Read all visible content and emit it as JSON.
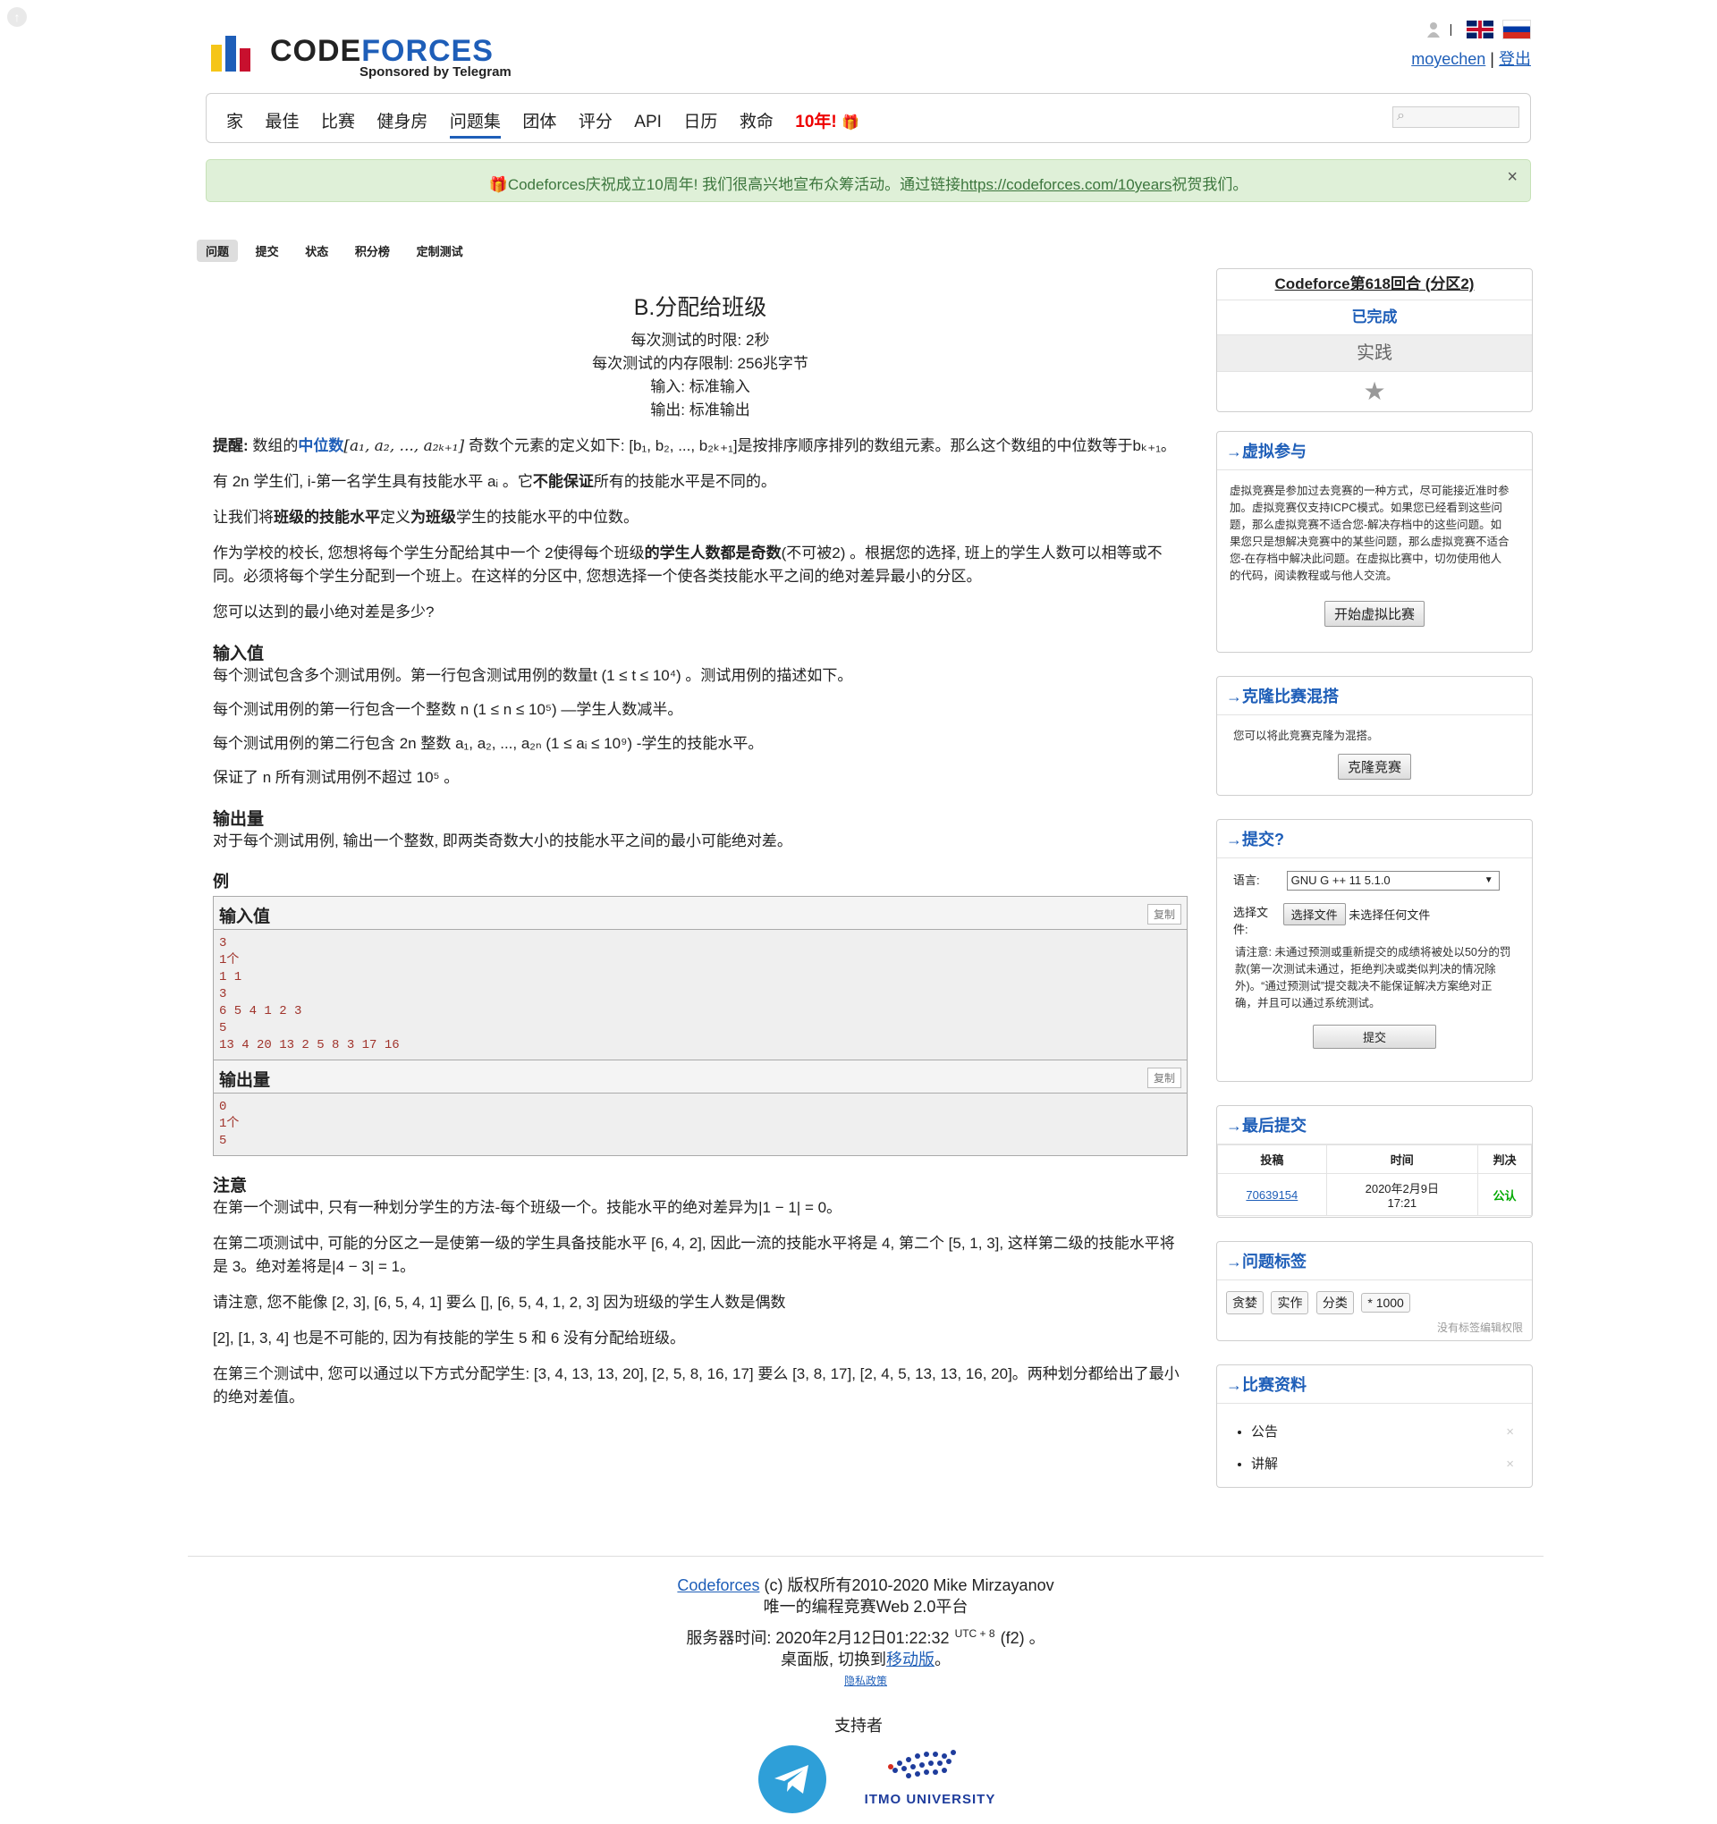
{
  "header": {
    "logo_text_a": "CODE",
    "logo_text_b": "FORCES",
    "sponsored": "Sponsored by Telegram",
    "username": "moyechen",
    "separator": "|",
    "logout": "登出",
    "lang_sep": "|"
  },
  "menu": [
    "家",
    "最佳",
    "比赛",
    "健身房",
    "问题集",
    "团体",
    "评分",
    "API",
    "日历",
    "救命",
    "10年!"
  ],
  "alert": {
    "prefix": "Codeforces庆祝成立10周年! 我们很高兴地宣布众筹活动。通过链接",
    "link": "https://codeforces.com/10years",
    "suffix": "祝贺我们。",
    "close": "×"
  },
  "subtabs": [
    "问题",
    "提交",
    "状态",
    "积分榜",
    "定制测试"
  ],
  "problem": {
    "title": "B.分配给班级",
    "time_limit": "每次测试的时限: 2秒",
    "memory_limit": "每次测试的内存限制: 256兆字节",
    "input": "输入: 标准输入",
    "output": "输出: 标准输出",
    "p1a": "提醒:",
    "p1b": "数组的",
    "p1c": "中位数",
    "p1d": "[a₁, a₂, ..., a₂ₖ₊₁]",
    "p1e": "奇数个元素的定义如下: [b₁, b₂, ..., b₂ₖ₊₁]是按排序顺序排列的数组元素。那么这个数组的中位数等于bₖ₊₁。",
    "p2": "有 2n 学生们, i-第一名学生具有技能水平 aᵢ 。它",
    "p2b": "不能保证",
    "p2c": "所有的技能水平是不同的。",
    "p3a": "让我们将",
    "p3b": "班级的技能水平",
    "p3c": "定义",
    "p3d": "为班级",
    "p3e": "学生的技能水平的中位数。",
    "p4a": "作为学校的校长, 您想将每个学生分配给其中一个 2使得每个班级",
    "p4b": "的学生人数都是奇数",
    "p4c": "(不可被2) 。根据您的选择, 班上的学生人数可以相等或不同。必须将每个学生分配到一个班上。在这样的分区中, 您想选择一个使各类技能水平之间的绝对差异最小的分区。",
    "p5": "您可以达到的最小绝对差是多少?",
    "input_head": "输入值",
    "in1": "每个测试包含多个测试用例。第一行包含测试用例的数量t (1 ≤ t ≤ 10⁴) 。测试用例的描述如下。",
    "in2": "每个测试用例的第一行包含一个整数 n (1 ≤ n ≤ 10⁵) —学生人数减半。",
    "in3": "每个测试用例的第二行包含 2n 整数 a₁, a₂, ..., a₂ₙ (1 ≤ aᵢ ≤ 10⁹) -学生的技能水平。",
    "in4": "保证了 n 所有测试用例不超过 10⁵ 。",
    "output_head": "输出量",
    "out1": "对于每个测试用例, 输出一个整数, 即两类奇数大小的技能水平之间的最小可能绝对差。",
    "example": "例",
    "sample_in_title": "输入值",
    "sample_out_title": "输出量",
    "copy": "复制",
    "sample_in": "3\n1个\n1 1\n3\n6 5 4 1 2 3\n5\n13 4 20 13 2 5 8 3 17 16",
    "sample_out": "0\n1个\n5",
    "note_head": "注意",
    "n1": "在第一个测试中, 只有一种划分学生的方法-每个班级一个。技能水平的绝对差异为|1 − 1| = 0。",
    "n2": "在第二项测试中, 可能的分区之一是使第一级的学生具备技能水平 [6, 4, 2], 因此一流的技能水平将是 4, 第二个 [5, 1, 3], 这样第二级的技能水平将是 3。绝对差将是|4 − 3| = 1。",
    "n3": "请注意, 您不能像 [2, 3], [6, 5, 4, 1] 要么 [], [6, 5, 4, 1, 2, 3] 因为班级的学生人数是偶数",
    "n4": "[2], [1, 3, 4] 也是不可能的, 因为有技能的学生 5 和 6 没有分配给班级。",
    "n5": "在第三个测试中, 您可以通过以下方式分配学生: [3, 4, 13, 13, 20], [2, 5, 8, 16, 17] 要么 [3, 8, 17], [2, 4, 5, 13, 13, 16, 20]。两种划分都给出了最小的绝对差值。"
  },
  "sidebar": {
    "contest_name": "Codeforce第618回合 (分区2)",
    "finished": "已完成",
    "practice": "实践",
    "virtual_title": "→虚拟参与",
    "virtual_text": "虚拟竞赛是参加过去竞赛的一种方式，尽可能接近准时参加。虚拟竞赛仅支持ICPC模式。如果您已经看到这些问题，那么虚拟竞赛不适合您-解决存档中的这些问题。如果您只是想解决竞赛中的某些问题，那么虚拟竞赛不适合您-在存档中解决此问题。在虚拟比赛中，切勿使用他人的代码，阅读教程或与他人交流。",
    "virtual_btn": "开始虚拟比赛",
    "clone_title": "→克隆比赛混搭",
    "clone_text": "您可以将此竞赛克隆为混搭。",
    "clone_btn": "克隆竞赛",
    "submit_title": "→提交?",
    "lang_label": "语言:",
    "lang_value": "GNU G ++ 11 5.1.0",
    "file_label": "选择文件:",
    "file_btn": "选择文件",
    "file_none": "未选择任何文件",
    "submit_note": "请注意: 未通过预测或重新提交的成绩将被处以50分的罚款(第一次测试未通过，拒绝判决或类似判决的情况除外)。“通过预测试”提交裁决不能保证解决方案绝对正确，并且可以通过系统测试。",
    "submit_btn": "提交",
    "last_title": "→最后提交",
    "last_headers": [
      "投稿",
      "时间",
      "判决"
    ],
    "last_row": {
      "id": "70639154",
      "date": "2020年2月9日",
      "time": "17:21",
      "verdict": "公认"
    },
    "tags_title": "→问题标签",
    "tags": [
      "贪婪",
      "实作",
      "分类",
      "* 1000"
    ],
    "tags_note": "没有标签编辑权限",
    "materials_title": "→比赛资料",
    "materials": [
      "公告",
      "讲解"
    ],
    "mat_x": "×"
  },
  "footer": {
    "l1a": "Codeforces",
    "l1b": "(c) 版权所有2010-2020 Mike Mirzayanov",
    "l2": "唯一的编程竞赛Web 2.0平台",
    "l3": "服务器时间: 2020年2月12日01:22:32",
    "utc": "UTC + 8",
    "l3b": "(f2) 。",
    "l4a": "桌面版, 切换到",
    "l4b": "移动版",
    "l4c": "。",
    "privacy": "隐私政策",
    "supported": "支持者",
    "itmo": "ITMO UNIVERSITY"
  },
  "colors": {
    "accent": "#1e5eb8",
    "alert_bg": "#dff0d8",
    "sample_text": "#a0332b",
    "verdict": "#0a0"
  },
  "icons": [
    "up-arrow-icon",
    "user-icon",
    "uk-flag-icon",
    "ru-flag-icon",
    "gift-icon",
    "search-icon",
    "close-icon",
    "star-icon",
    "telegram-icon",
    "itmo-logo"
  ]
}
